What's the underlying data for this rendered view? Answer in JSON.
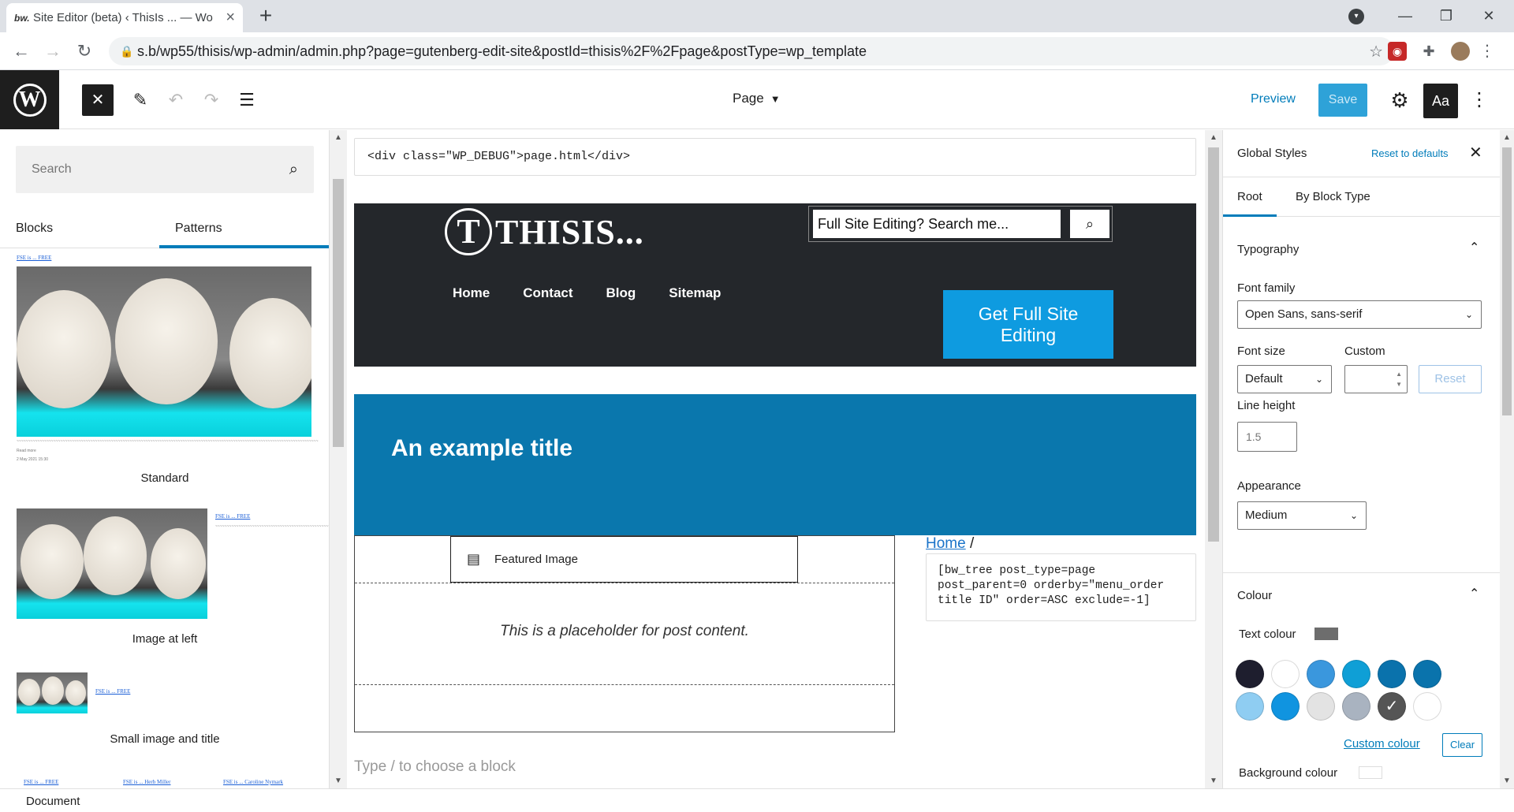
{
  "browser": {
    "tab_title": "Site Editor (beta) ‹ ThisIs ... — Wo",
    "tab_favicon": "bw.",
    "url": "s.b/wp55/thisis/wp-admin/admin.php?page=gutenberg-edit-site&postId=thisis%2F%2Fpage&postType=wp_template"
  },
  "editor_header": {
    "template_name": "Page",
    "preview_label": "Preview",
    "save_label": "Save",
    "styles_label": "Aa",
    "wp_logo": "W"
  },
  "inserter": {
    "search_placeholder": "Search",
    "tabs": [
      "Blocks",
      "Patterns"
    ],
    "active_tab": "Patterns",
    "patterns": [
      {
        "label": "Standard",
        "link": "FSE is ... FREE"
      },
      {
        "label": "Image at left",
        "link": "FSE is ... FREE"
      },
      {
        "label": "Small image and title",
        "link": "FSE is ... FREE"
      }
    ],
    "bottom_links": [
      "FSE is ... FREE",
      "FSE is ... Herb Miller",
      "FSE is ... Caroline Nymark"
    ],
    "tiny_date": "2 May 2021 15:30",
    "tiny_read_more": "Read more"
  },
  "canvas": {
    "debug_html": "<div class=\"WP_DEBUG\">page.html</div>",
    "logo_mark": "T",
    "site_name": "THISIS...",
    "site_search_placeholder": "Full Site Editing? Search me...",
    "nav": [
      "Home",
      "Contact",
      "Blog",
      "Sitemap"
    ],
    "cta_label": "Get Full Site Editing",
    "hero_title": "An example title",
    "featured_image_label": "Featured Image",
    "post_content_placeholder": "This is a placeholder for post content.",
    "breadcrumb_home": "Home",
    "breadcrumb_sep": "/",
    "shortcode": "[bw_tree post_type=page\npost_parent=0 orderby=\"menu_order\ntitle ID\" order=ASC exclude=-1]",
    "appender_placeholder": "Type / to choose a block"
  },
  "sidebar": {
    "title": "Global Styles",
    "reset_label": "Reset to defaults",
    "tabs": [
      "Root",
      "By Block Type"
    ],
    "active_tab": "Root",
    "typography": {
      "title": "Typography",
      "font_family_label": "Font family",
      "font_family_value": "Open Sans, sans-serif",
      "font_size_label": "Font size",
      "font_size_value": "Default",
      "custom_label": "Custom",
      "custom_value": "",
      "reset_label": "Reset",
      "line_height_label": "Line height",
      "line_height_placeholder": "1.5",
      "appearance_label": "Appearance",
      "appearance_value": "Medium"
    },
    "colour": {
      "title": "Colour",
      "text_colour_label": "Text colour",
      "text_colour_value": "#6d6d6d",
      "palette": [
        "#1e1e2e",
        "#ffffff",
        "#3a97dd",
        "#0f9fd6",
        "#0a72ac",
        "#0a73ac",
        "#8fcdf2",
        "#1094e0",
        "#e3e3e3",
        "#a9b3c0",
        "#555555",
        "#ffffff"
      ],
      "selected_index": 10,
      "custom_colour_label": "Custom colour",
      "clear_label": "Clear",
      "background_colour_label": "Background colour",
      "background_colour_value": "#ffffff"
    }
  },
  "footer": {
    "breadcrumb": "Document"
  }
}
